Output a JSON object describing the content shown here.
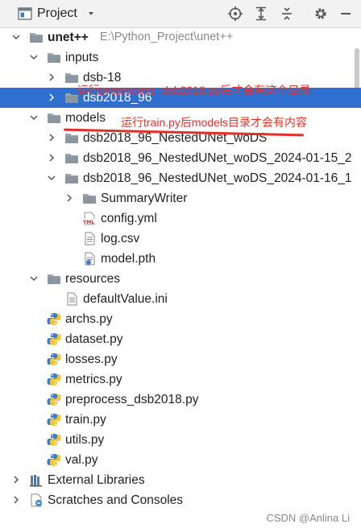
{
  "toolbar": {
    "title": "Project",
    "icons": [
      "locate-icon",
      "expand-all-icon",
      "collapse-all-icon",
      "settings-icon",
      "hide-icon"
    ]
  },
  "tree": [
    {
      "label": "unet++",
      "hint": "E:\\Python_Project\\unet++",
      "bold": true,
      "icon": "folder",
      "expanded": true
    },
    {
      "label": "inputs",
      "icon": "folder",
      "expanded": true
    },
    {
      "label": "dsb-18",
      "icon": "folder",
      "expanded": false
    },
    {
      "label": "dsb2018_96",
      "icon": "folder",
      "expanded": false,
      "selected": true
    },
    {
      "label": "models",
      "icon": "folder",
      "expanded": true
    },
    {
      "label": "dsb2018_96_NestedUNet_woDS",
      "icon": "folder",
      "expanded": false
    },
    {
      "label": "dsb2018_96_NestedUNet_woDS_2024-01-15_2",
      "icon": "folder",
      "expanded": false
    },
    {
      "label": "dsb2018_96_NestedUNet_woDS_2024-01-16_1",
      "icon": "folder",
      "expanded": true
    },
    {
      "label": "SummaryWriter",
      "icon": "folder",
      "expanded": false
    },
    {
      "label": "config.yml",
      "icon": "yml"
    },
    {
      "label": "log.csv",
      "icon": "text-file"
    },
    {
      "label": "model.pth",
      "icon": "pth-file"
    },
    {
      "label": "resources",
      "icon": "folder",
      "expanded": true
    },
    {
      "label": "defaultValue.ini",
      "icon": "text-file"
    },
    {
      "label": "archs.py",
      "icon": "python"
    },
    {
      "label": "dataset.py",
      "icon": "python"
    },
    {
      "label": "losses.py",
      "icon": "python"
    },
    {
      "label": "metrics.py",
      "icon": "python"
    },
    {
      "label": "preprocess_dsb2018.py",
      "icon": "python"
    },
    {
      "label": "train.py",
      "icon": "python"
    },
    {
      "label": "utils.py",
      "icon": "python"
    },
    {
      "label": "val.py",
      "icon": "python"
    },
    {
      "label": "External Libraries",
      "icon": "libraries",
      "expanded": false
    },
    {
      "label": "Scratches and Consoles",
      "icon": "scratches",
      "expanded": false
    }
  ],
  "annotations": {
    "note1": "运行preprocess_dsb2018.py后才会有这个目录",
    "note2": "运行train.py后models目录才会有内容",
    "color": "#e8302a"
  },
  "watermark": "CSDN @Anlina Li",
  "colors": {
    "selection": "#2f6fcf",
    "folder": "#9aa4ad",
    "python_blue": "#3d7cc9",
    "python_yellow": "#f4c531"
  }
}
